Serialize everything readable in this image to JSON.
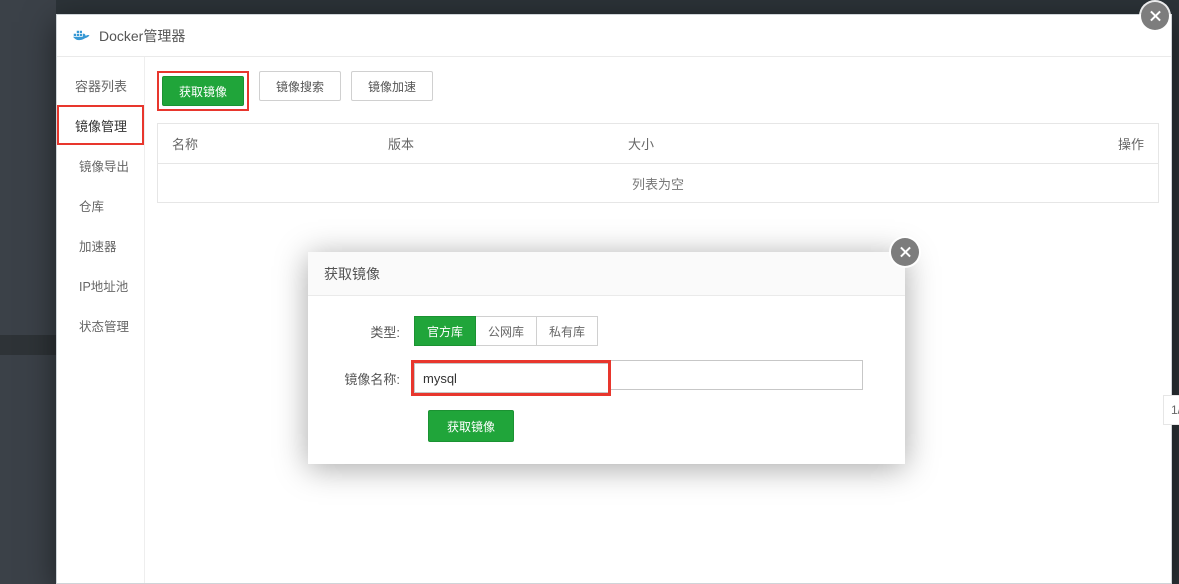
{
  "window": {
    "title": "Docker管理器"
  },
  "sidebar": {
    "items": [
      {
        "label": "容器列表"
      },
      {
        "label": "镜像管理"
      },
      {
        "label": "镜像导出"
      },
      {
        "label": "仓库"
      },
      {
        "label": "加速器"
      },
      {
        "label": "IP地址池"
      },
      {
        "label": "状态管理"
      }
    ]
  },
  "toolbar": {
    "pull": "获取镜像",
    "search": "镜像搜索",
    "accel": "镜像加速"
  },
  "table": {
    "headers": {
      "name": "名称",
      "version": "版本",
      "size": "大小",
      "op": "操作"
    },
    "empty": "列表为空"
  },
  "dialog": {
    "title": "获取镜像",
    "labels": {
      "type": "类型:",
      "name": "镜像名称:"
    },
    "type_options": {
      "official": "官方库",
      "public": "公网库",
      "private": "私有库"
    },
    "name_value": "mysql",
    "submit": "获取镜像"
  },
  "pagination": {
    "text": "1/"
  }
}
